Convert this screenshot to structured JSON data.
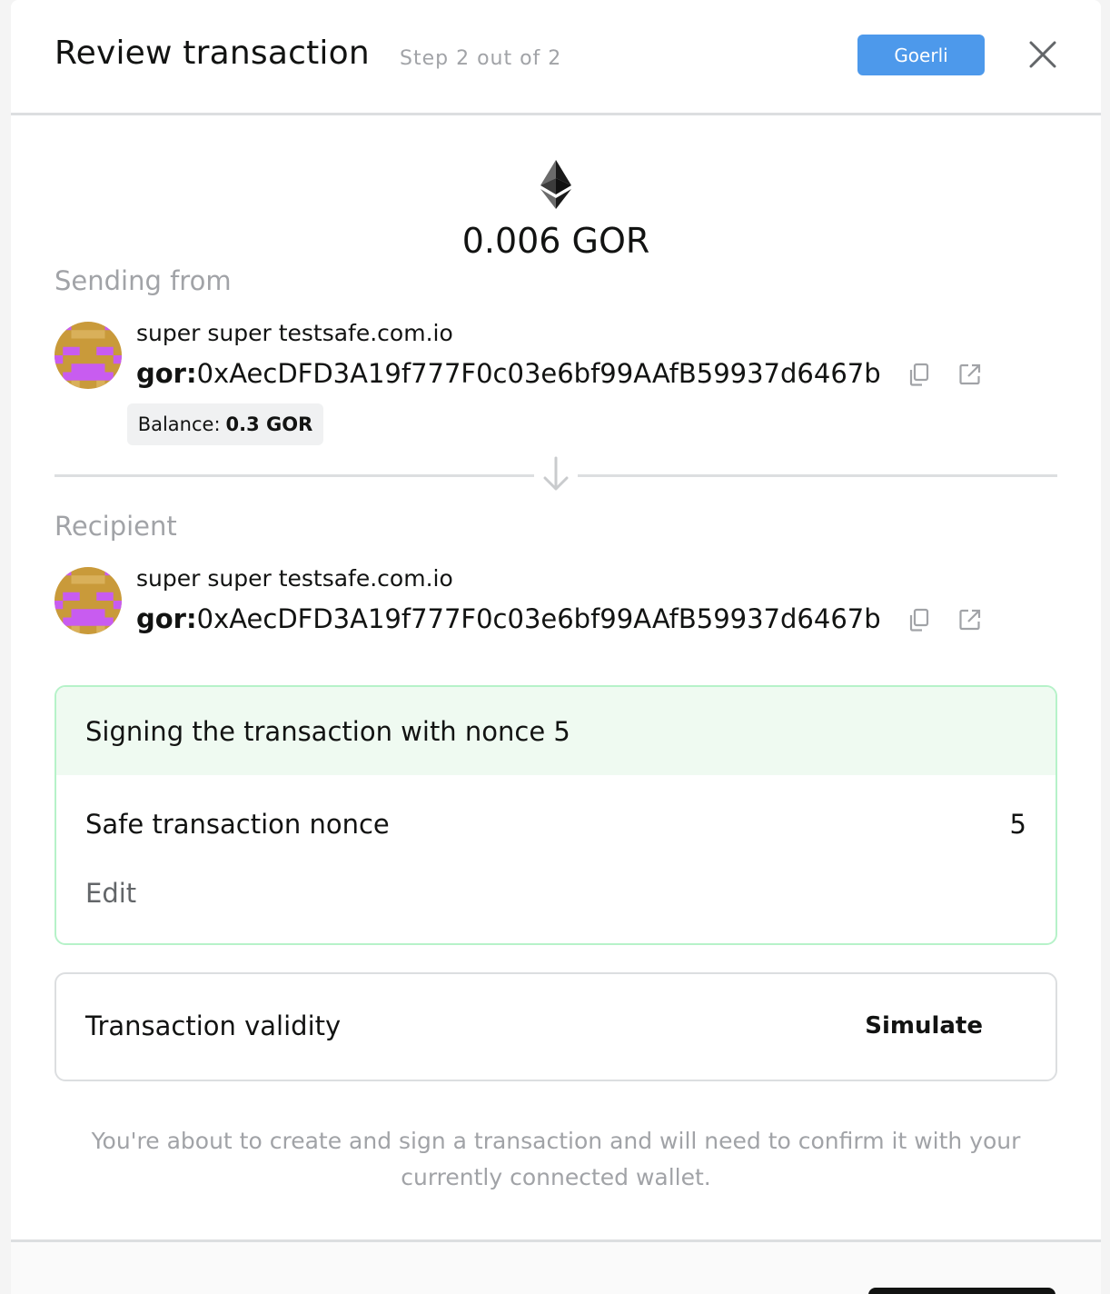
{
  "header": {
    "title": "Review transaction",
    "step": "Step 2 out of 2",
    "network": "Goerli"
  },
  "amount": "0.006 GOR",
  "sending_from": {
    "label": "Sending from",
    "name": "super super testsafe.com.io",
    "prefix": "gor:",
    "address": "0xAecDFD3A19f777F0c03e6bf99AAfB59937d6467b",
    "balance_label": "Balance:",
    "balance_value": "0.3 GOR"
  },
  "recipient": {
    "label": "Recipient",
    "name": "super super testsafe.com.io",
    "prefix": "gor:",
    "address": "0xAecDFD3A19f777F0c03e6bf99AAfB59937d6467b"
  },
  "nonce": {
    "heading": "Signing the transaction with nonce 5",
    "label": "Safe transaction nonce",
    "value": "5",
    "edit_label": "Edit"
  },
  "validity": {
    "label": "Transaction validity",
    "action_label": "Simulate"
  },
  "notice": "You're about to create and sign a transaction and will need to confirm it with your currently connected wallet.",
  "colors": {
    "network_badge": "#4d99eb",
    "nonce_header_bg": "#effaf1",
    "nonce_border": "#b6f2c9",
    "avatar_base": "#c99a3a",
    "avatar_accent": "#c85cf0"
  },
  "icons": {
    "close": "close-icon",
    "copy": "copy-icon",
    "external": "external-link-icon",
    "arrow": "arrow-down-icon",
    "token": "ethereum-icon"
  }
}
